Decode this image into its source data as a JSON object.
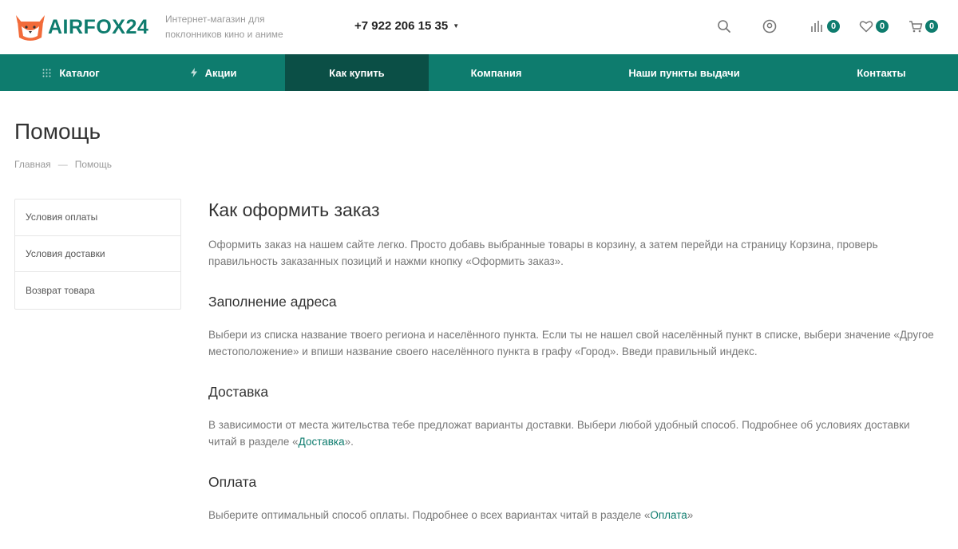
{
  "header": {
    "logo_text": "AIRFOX24",
    "tagline": "Интернет-магазин для поклонников кино и аниме",
    "phone": "+7 922 206 15 35",
    "compare_count": "0",
    "favorites_count": "0",
    "cart_count": "0"
  },
  "nav": {
    "items": [
      {
        "label": "Каталог",
        "icon": "grid-icon"
      },
      {
        "label": "Акции",
        "icon": "lightning-icon"
      },
      {
        "label": "Как купить",
        "active": true
      },
      {
        "label": "Компания"
      },
      {
        "label": "Наши пункты выдачи"
      },
      {
        "label": "Контакты"
      }
    ]
  },
  "page": {
    "title": "Помощь",
    "breadcrumb": {
      "home": "Главная",
      "separator": "—",
      "current": "Помощь"
    }
  },
  "sidebar": {
    "items": [
      {
        "label": "Условия оплаты"
      },
      {
        "label": "Условия доставки"
      },
      {
        "label": "Возврат товара"
      }
    ]
  },
  "content": {
    "title": "Как оформить заказ",
    "intro": "Оформить заказ на нашем сайте легко. Просто добавь выбранные товары в корзину, а затем перейди на страницу Корзина, проверь правильность заказанных позиций и нажми кнопку «Оформить заказ».",
    "address": {
      "heading": "Заполнение адреса",
      "text": "Выбери из списка название твоего региона и населённого пункта. Если ты не нашел свой населённый пункт в списке, выбери значение «Другое местоположение» и впиши название своего населённого пункта в графу «Город». Введи правильный индекс."
    },
    "delivery": {
      "heading": "Доставка",
      "text_before": "В зависимости от места жительства тебе предложат варианты доставки. Выбери любой удобный способ. Подробнее об условиях доставки читай в разделе «",
      "link": "Доставка",
      "text_after": "»."
    },
    "payment": {
      "heading": "Оплата",
      "text_before": "Выберите оптимальный способ оплаты. Подробнее о всех вариантах читай в разделе «",
      "link": "Оплата",
      "text_after": "»"
    }
  },
  "colors": {
    "brand": "#0e7c6e",
    "nav_active": "#0b4f46",
    "logo_accent": "#f26b3a"
  }
}
